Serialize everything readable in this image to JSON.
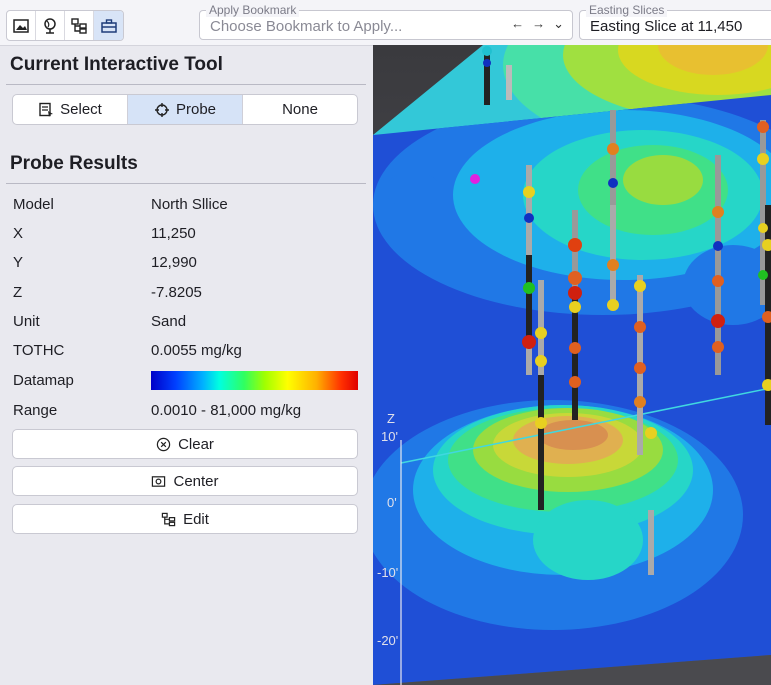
{
  "toolbar": {
    "icons": [
      "image-icon",
      "globe-icon",
      "hierarchy-icon",
      "toolbox-icon"
    ]
  },
  "bookmark": {
    "legend": "Apply Bookmark",
    "placeholder": "Choose Bookmark to Apply...",
    "controls": [
      "←",
      "→",
      "⌄"
    ]
  },
  "easting": {
    "legend": "Easting Slices",
    "value": "Easting Slice at 11,450"
  },
  "tool_panel": {
    "title": "Current Interactive Tool",
    "buttons": [
      "Select",
      "Probe",
      "None"
    ],
    "active": "Probe"
  },
  "probe": {
    "title": "Probe Results",
    "rows": [
      {
        "key": "Model",
        "value": "North Sllice"
      },
      {
        "key": "X",
        "value": "11,250"
      },
      {
        "key": "Y",
        "value": "12,990"
      },
      {
        "key": "Z",
        "value": "-7.8205"
      },
      {
        "key": "Unit",
        "value": "Sand"
      },
      {
        "key": "TOTHC",
        "value": "0.0055 mg/kg"
      },
      {
        "key": "Datamap",
        "value": ""
      },
      {
        "key": "Range",
        "value": "0.0010 - 81,000 mg/kg"
      }
    ]
  },
  "actions": {
    "clear": "Clear",
    "center": "Center",
    "edit": "Edit"
  },
  "axis": {
    "z_label": "Z",
    "ticks": [
      "10'",
      "0'",
      "-10'",
      "-20'"
    ]
  }
}
